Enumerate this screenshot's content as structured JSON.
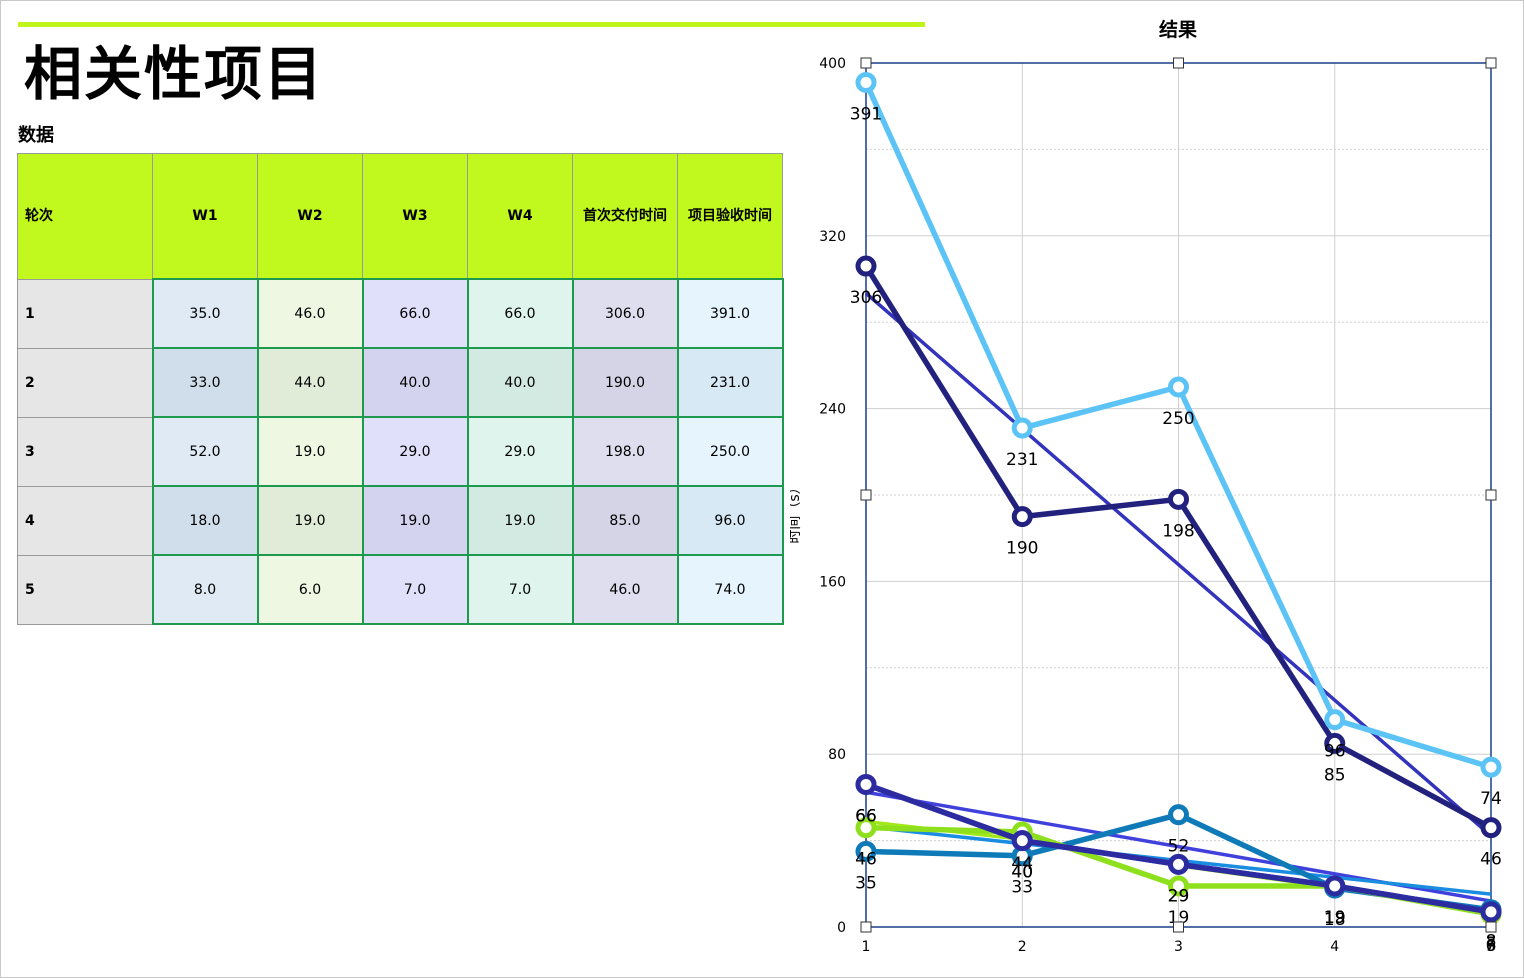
{
  "page": {
    "title": "相关性项目",
    "data_label": "数据"
  },
  "table": {
    "headers": [
      "轮次",
      "W1",
      "W2",
      "W3",
      "W4",
      "首次交付时间",
      "项目验收时间"
    ],
    "rows": [
      [
        "1",
        "35.0",
        "46.0",
        "66.0",
        "66.0",
        "306.0",
        "391.0"
      ],
      [
        "2",
        "33.0",
        "44.0",
        "40.0",
        "40.0",
        "190.0",
        "231.0"
      ],
      [
        "3",
        "52.0",
        "19.0",
        "29.0",
        "29.0",
        "198.0",
        "250.0"
      ],
      [
        "4",
        "18.0",
        "19.0",
        "19.0",
        "19.0",
        "85.0",
        "96.0"
      ],
      [
        "5",
        "8.0",
        "6.0",
        "7.0",
        "7.0",
        "46.0",
        "74.0"
      ]
    ]
  },
  "chart_data": {
    "type": "line",
    "title": "结果",
    "xlabel": "",
    "ylabel": "时间（s）",
    "x": [
      1,
      2,
      3,
      4,
      5
    ],
    "x_tick_labels": [
      "1",
      "2",
      "3",
      "4",
      "5"
    ],
    "ylim": [
      0,
      400
    ],
    "y_ticks": [
      0,
      80,
      160,
      240,
      320,
      400
    ],
    "grid": true,
    "legend": "none",
    "series": [
      {
        "values": [
          35,
          33,
          52,
          18,
          8
        ],
        "color": "#0f7ab8",
        "markers": true
      },
      {
        "values": [
          46,
          44,
          19,
          19,
          6
        ],
        "color": "#8ee01c",
        "markers": true
      },
      {
        "values": [
          66,
          40,
          29,
          19,
          7
        ],
        "color": "#4040dc",
        "markers": true
      },
      {
        "values": [
          66,
          40,
          29,
          19,
          7
        ],
        "color": "#2c2ca0",
        "markers": true
      },
      {
        "values": [
          306,
          190,
          198,
          85,
          46
        ],
        "color": "#22227e",
        "markers": true
      },
      {
        "values": [
          391,
          231,
          250,
          96,
          74
        ],
        "color": "#5bc3f5",
        "markers": true
      }
    ],
    "trendlines": [
      {
        "values": [
          293.4,
          230.6,
          167.8,
          105.0,
          42.2
        ],
        "color": "#3333bb"
      },
      {
        "values": [
          62.4,
          49.8,
          37.2,
          24.6,
          12.0
        ],
        "color": "#4040dc"
      },
      {
        "values": [
          46.4,
          38.6,
          30.8,
          23.0,
          15.2
        ],
        "color": "#1a8de0"
      },
      {
        "values": [
          48.8,
          40.6,
          28.4,
          18.2,
          8.0
        ],
        "color": "#a2e81a"
      }
    ]
  }
}
